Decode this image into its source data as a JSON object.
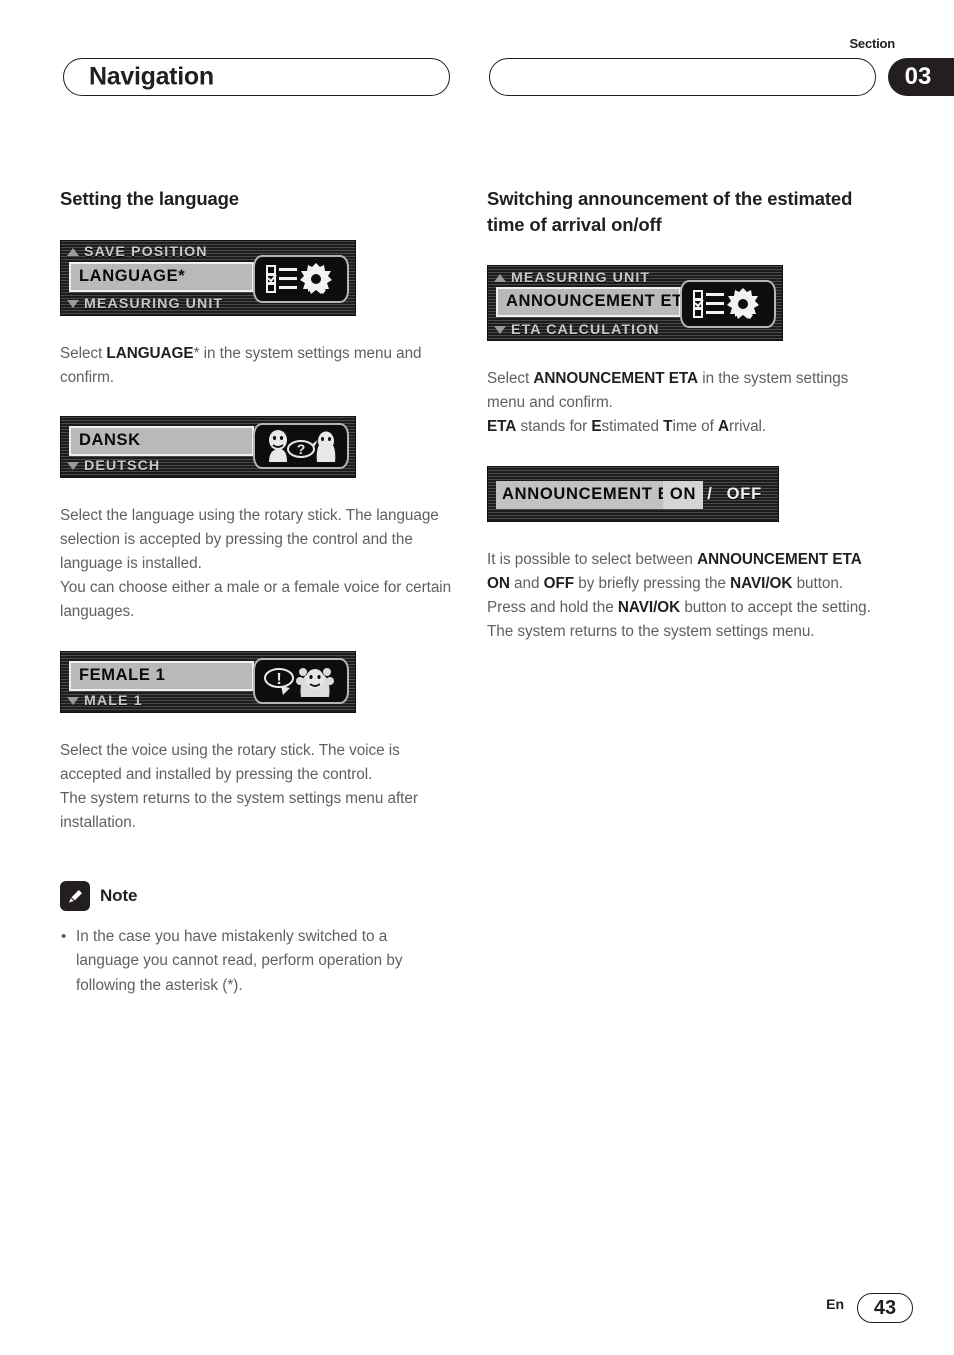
{
  "header": {
    "title": "Navigation",
    "section_label": "Section",
    "section_number": "03"
  },
  "left_column": {
    "heading": "Setting the language",
    "lcd_language_menu": {
      "row_top": "SAVE POSITION",
      "row_selected": "LANGUAGE*",
      "row_bottom": "MEASURING UNIT",
      "icon": "settings-checklist-gear-icon",
      "arrow_up": "scroll-up-arrow-icon",
      "arrow_down": "scroll-down-arrow-icon"
    },
    "para_1_pre": "Select ",
    "para_1_bold": "LANGUAGE",
    "para_1_post": "* in the system settings menu and confirm.",
    "lcd_language_list": {
      "row_selected": "DANSK",
      "row_bottom": "DEUTSCH",
      "icon": "two-faces-question-bubble-icon",
      "arrow_down": "scroll-down-arrow-icon"
    },
    "para_2": "Select the language using the rotary stick. The language selection is accepted by pressing the control and the language is installed.",
    "para_3": "You can choose either a male or a female voice for certain languages.",
    "lcd_voice_list": {
      "row_selected": "FEMALE 1",
      "row_bottom": "MALE 1",
      "icon": "face-exclamation-bubble-icon",
      "arrow_down": "scroll-down-arrow-icon"
    },
    "para_4": "Select the voice using the rotary stick. The voice is accepted and installed by pressing the control.",
    "para_5": "The system returns to the system settings menu after installation.",
    "note": {
      "icon": "pencil-note-icon",
      "title": "Note",
      "items": [
        "In the case you have mistakenly switched to a language you cannot read, perform operation by following the asterisk (*)."
      ]
    }
  },
  "right_column": {
    "heading": "Switching announcement of the estimated time of arrival on/off",
    "lcd_eta_menu": {
      "row_top": "MEASURING UNIT",
      "row_selected": "ANNOUNCEMENT ETA",
      "row_bottom": "ETA CALCULATION",
      "icon": "settings-checklist-gear-icon",
      "arrow_up": "scroll-up-arrow-icon",
      "arrow_down": "scroll-down-arrow-icon"
    },
    "para_1_pre": "Select ",
    "para_1_bold": "ANNOUNCEMENT ETA",
    "para_1_post": " in the system settings menu and confirm.",
    "para_2_segments": [
      {
        "text": "ETA",
        "bold": true
      },
      {
        "text": " stands for ",
        "bold": false
      },
      {
        "text": "E",
        "bold": true
      },
      {
        "text": "stimated ",
        "bold": false
      },
      {
        "text": "T",
        "bold": true
      },
      {
        "text": "ime of ",
        "bold": false
      },
      {
        "text": "A",
        "bold": true
      },
      {
        "text": "rrival.",
        "bold": false
      }
    ],
    "lcd_eta_onoff": {
      "label": "ANNOUNCEMENT ETA",
      "option_on": "ON",
      "separator": "/",
      "option_off": "OFF",
      "selected": "ON"
    },
    "para_3_segments": [
      {
        "text": "It is possible to select between ",
        "bold": false
      },
      {
        "text": "ANNOUNCEMENT ETA ON",
        "bold": true
      },
      {
        "text": " and ",
        "bold": false
      },
      {
        "text": "OFF",
        "bold": true
      },
      {
        "text": " by briefly pressing the ",
        "bold": false
      },
      {
        "text": "NAVI/OK",
        "bold": true
      },
      {
        "text": " button.",
        "bold": false
      }
    ],
    "para_4_segments": [
      {
        "text": "Press and hold the ",
        "bold": false
      },
      {
        "text": "NAVI/OK",
        "bold": true
      },
      {
        "text": " button to accept the setting.",
        "bold": false
      }
    ],
    "para_5": "The system returns to the system settings menu."
  },
  "footer": {
    "language_code": "En",
    "page_number": "43"
  }
}
